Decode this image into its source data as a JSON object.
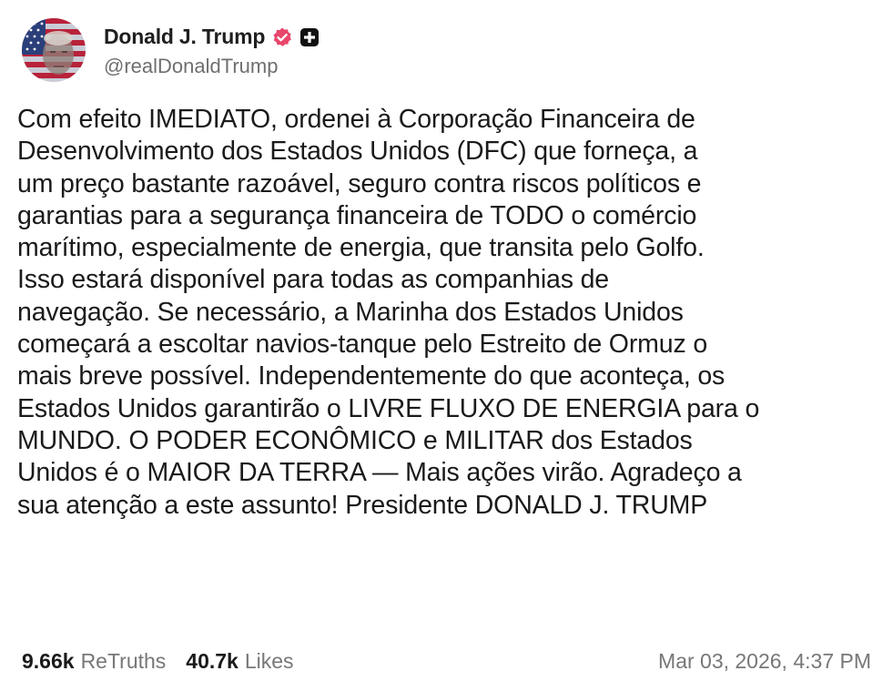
{
  "author": {
    "display_name": "Donald J. Trump",
    "handle": "@realDonaldTrump",
    "verified_icon": "verified-badge-icon",
    "verified_color": "#E8466B",
    "extra_icon": "plus-square-icon"
  },
  "post": {
    "lines": [
      "Com efeito IMEDIATO, ordenei à Corporação Financeira de",
      "Desenvolvimento dos Estados Unidos (DFC) que forneça, a",
      "um preço bastante razoável, seguro contra riscos políticos e",
      "garantias para a segurança financeira de TODO o comércio",
      "marítimo, especialmente de energia, que transita pelo Golfo.",
      "Isso estará disponível para todas as companhias de",
      "navegação. Se necessário, a Marinha dos Estados Unidos",
      "começará a escoltar navios-tanque pelo Estreito de Ormuz o",
      "mais breve possível. Independentemente do que aconteça, os",
      "Estados Unidos garantirão o LIVRE FLUXO DE ENERGIA para o",
      "MUNDO. O PODER ECONÔMICO e MILITAR dos Estados",
      "Unidos é o MAIOR DA TERRA — Mais ações virão. Agradeço a",
      "sua atenção a este assunto! Presidente DONALD J. TRUMP"
    ]
  },
  "stats": {
    "retruths_count": "9.66k",
    "retruths_label": "ReTruths",
    "likes_count": "40.7k",
    "likes_label": "Likes"
  },
  "timestamp": "Mar 03, 2026, 4:37 PM"
}
